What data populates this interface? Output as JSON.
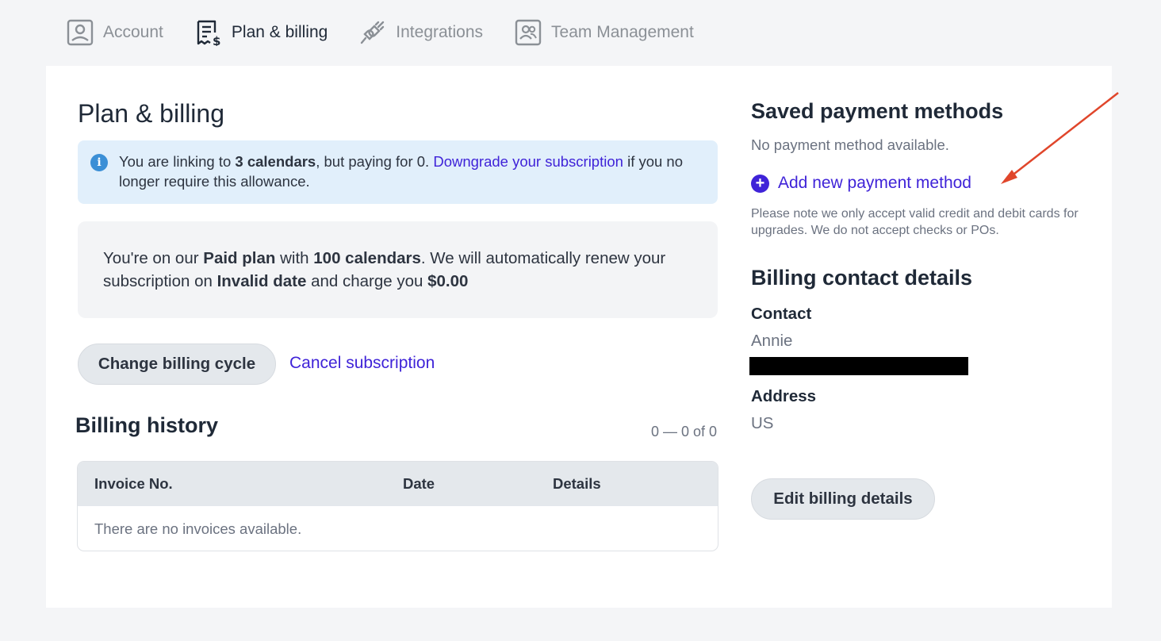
{
  "tabs": [
    {
      "label": "Account",
      "icon": "account-icon",
      "active": false
    },
    {
      "label": "Plan & billing",
      "icon": "billing-icon",
      "active": true
    },
    {
      "label": "Integrations",
      "icon": "integrations-icon",
      "active": false
    },
    {
      "label": "Team Management",
      "icon": "team-icon",
      "active": false
    }
  ],
  "main": {
    "title": "Plan & billing",
    "alert": {
      "prefix": "You are linking to ",
      "calendars": "3 calendars",
      "middle": ", but paying for 0. ",
      "link": "Downgrade your subscription",
      "suffix": " if you no longer require this allowance."
    },
    "plan": {
      "t1": "You're on our ",
      "plan_name": "Paid plan",
      "t2": " with ",
      "calendars": "100 calendars",
      "t3": ". We will automatically renew your subscription on ",
      "renew_date": "Invalid date",
      "t4": " and charge you ",
      "amount": "$0.00"
    },
    "change_cycle_label": "Change billing cycle",
    "cancel_label": "Cancel subscription",
    "history": {
      "title": "Billing history",
      "pager": "0 — 0 of 0",
      "columns": [
        "Invoice No.",
        "Date",
        "Details"
      ],
      "empty": "There are no invoices available."
    }
  },
  "payment": {
    "title": "Saved payment methods",
    "none": "No payment method available.",
    "add_label": "Add new payment method",
    "note": "Please note we only accept valid credit and debit cards for upgrades. We do not accept checks or POs."
  },
  "billing_contact": {
    "title": "Billing contact details",
    "contact_label": "Contact",
    "contact_name": "Annie",
    "address_label": "Address",
    "address": "US",
    "edit_label": "Edit billing details"
  },
  "colors": {
    "accent": "#3f23d8",
    "annotation_arrow": "#e0462b",
    "info": "#3b8fd6"
  }
}
